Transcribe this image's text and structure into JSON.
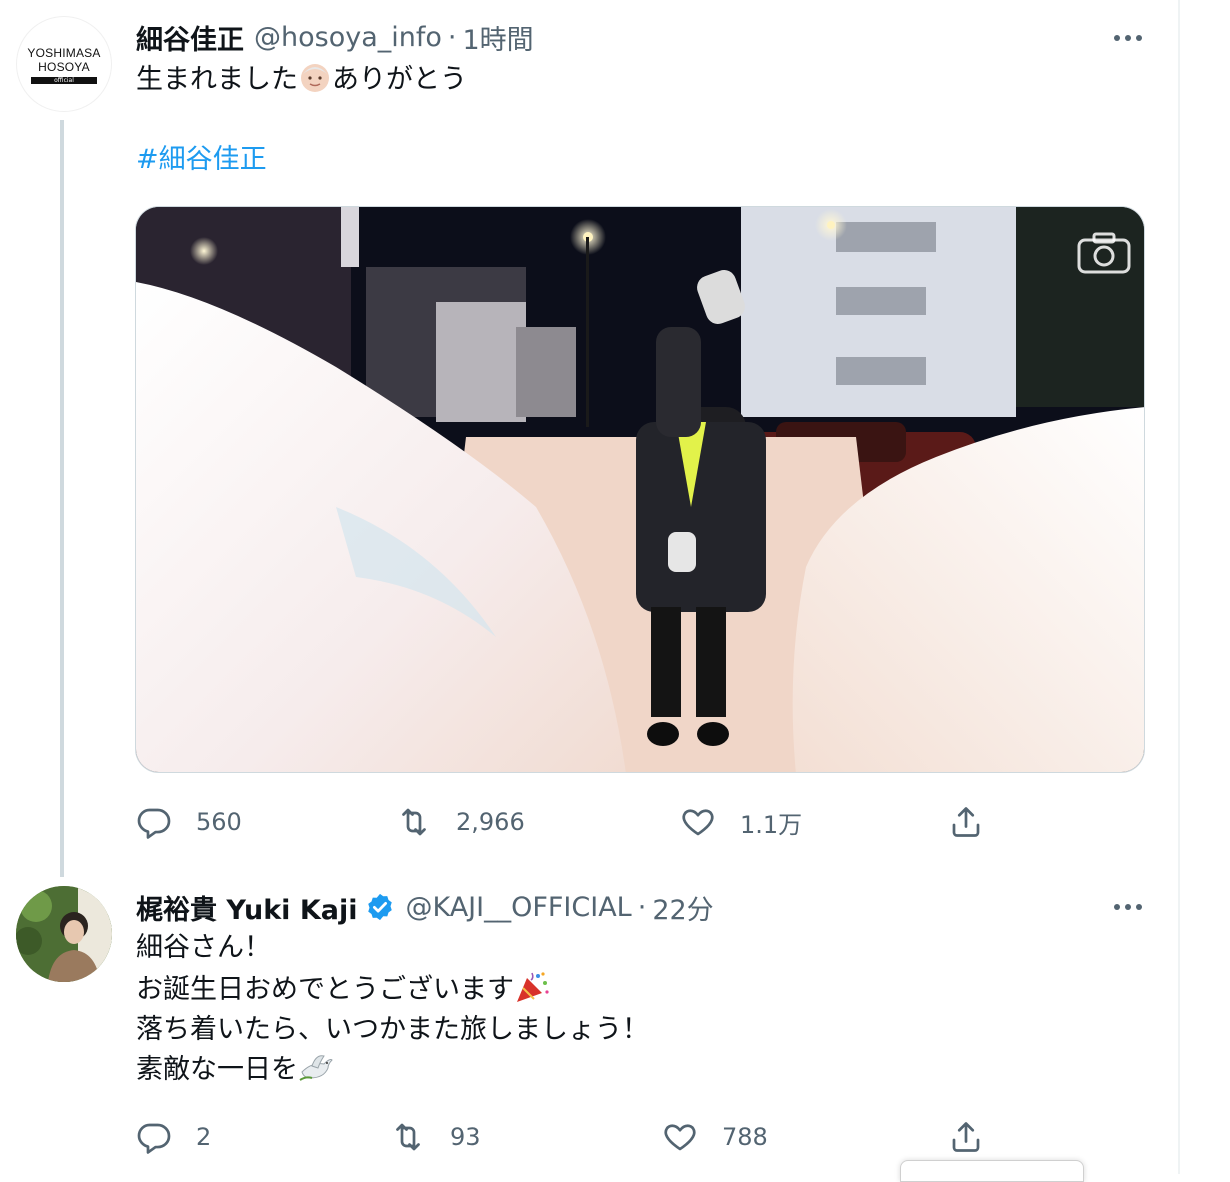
{
  "tweet1": {
    "avatar": {
      "line1": "YOSHIMASA",
      "line2": "HOSOYA",
      "line3": "official"
    },
    "name": "細谷佳正",
    "handle": "@hosoya_info",
    "separator": "·",
    "time": "1時間",
    "text_before_emoji": "生まれました",
    "emoji_name": "baby-face-emoji",
    "text_after_emoji": "ありがとう",
    "hashtag": "#細谷佳正",
    "media_icon": "camera-icon",
    "actions": {
      "reply": "560",
      "retweet": "2,966",
      "like": "1.1万"
    }
  },
  "tweet2": {
    "name": "梶裕貴 Yuki Kaji",
    "verified_icon": "verified-badge-icon",
    "handle": "@KAJI__OFFICIAL",
    "separator": "·",
    "time": "22分",
    "lines": [
      "細谷さん！",
      "お誕生日おめでとうございます",
      "落ち着いたら、いつかまた旅しましょう！",
      "素敵な一日を"
    ],
    "line2_emoji": "party-popper-emoji",
    "line4_emoji": "dove-emoji",
    "actions": {
      "reply": "2",
      "retweet": "93",
      "like": "788"
    }
  },
  "colors": {
    "accent": "#1d9bf0",
    "muted": "#536471",
    "thread_line": "#cfd9de"
  }
}
